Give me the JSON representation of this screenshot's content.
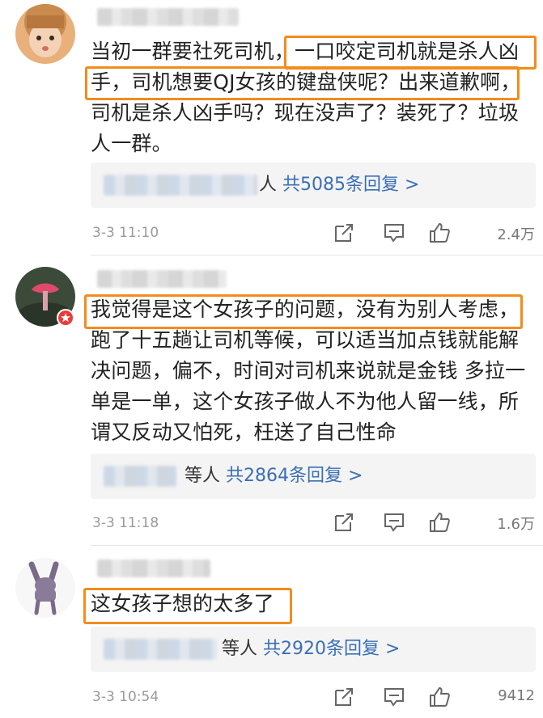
{
  "comments": [
    {
      "lines": [
        "当初一群要社死司机，一口咬定司机就是杀人凶",
        "手，司机想要QJ女孩的键盘侠呢？出来道歉啊，",
        "司机是杀人凶手吗？现在没声了？装死了？垃圾",
        "人一群。"
      ],
      "reply_suffix": "人",
      "reply_count": "共5085条回复 >",
      "timestamp": "3-3 11:10",
      "likes": "2.4万"
    },
    {
      "lines": [
        "我觉得是这个女孩子的问题，没有为别人考虑，",
        "跑了十五趟让司机等候，可以适当加点钱就能解",
        "决问题，偏不，时间对司机来说就是金钱 多拉一",
        "单是一单，这个女孩子做人不为他人留一线，所",
        "谓又反动又怕死，枉送了自己性命"
      ],
      "reply_suffix": "等人",
      "reply_count": "共2864条回复 >",
      "timestamp": "3-3 11:18",
      "likes": "1.6万"
    },
    {
      "lines": [
        "这女孩子想的太多了"
      ],
      "reply_suffix": "等人",
      "reply_count": "共2920条回复 >",
      "timestamp": "3-3 10:54",
      "likes": "9412"
    }
  ],
  "colors": {
    "highlight": "#f28c1c",
    "reply_link": "#3a6fb5",
    "meta": "#9a9a9a"
  },
  "icons": [
    "forward-icon",
    "comment-icon",
    "like-icon",
    "vip-badge-icon"
  ]
}
